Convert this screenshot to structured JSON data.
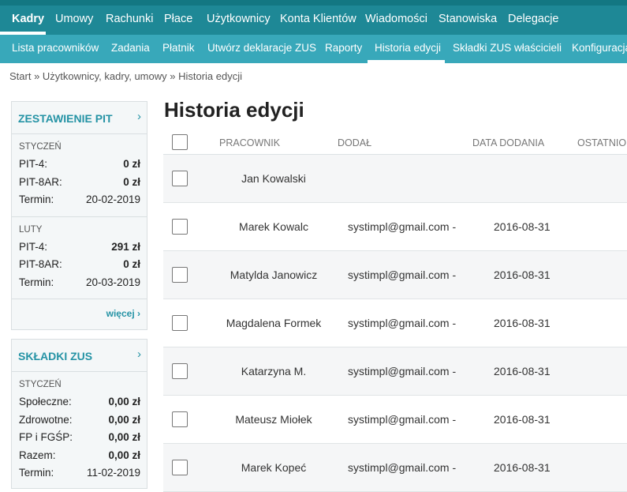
{
  "top_nav": {
    "items": [
      "Kadry",
      "Umowy",
      "Rachunki",
      "Płace",
      "Użytkownicy",
      "Konta Klientów",
      "Wiadomości",
      "Stanowiska",
      "Delegacje"
    ],
    "active": "Kadry"
  },
  "sub_nav": {
    "items": [
      "Lista pracowników",
      "Zadania",
      "Płatnik",
      "Utwórz deklaracje ZUS",
      "Raporty",
      "Historia edycji",
      "Składki ZUS właścicieli",
      "Konfiguracja"
    ],
    "active": "Historia edycji"
  },
  "breadcrumb": "Start » Użytkownicy, kadry, umowy » Historia edycji",
  "pit_panel": {
    "title": "ZESTAWIENIE PIT",
    "months": [
      {
        "month": "STYCZEŃ",
        "rows": [
          {
            "label": "PIT-4:",
            "value": "0 zł"
          },
          {
            "label": "PIT-8AR:",
            "value": "0 zł"
          },
          {
            "label": "Termin:",
            "value": "20-02-2019"
          }
        ]
      },
      {
        "month": "LUTY",
        "rows": [
          {
            "label": "PIT-4:",
            "value": "291 zł"
          },
          {
            "label": "PIT-8AR:",
            "value": "0 zł"
          },
          {
            "label": "Termin:",
            "value": "20-03-2019"
          }
        ]
      }
    ],
    "more": "więcej"
  },
  "zus_panel": {
    "title": "SKŁADKI ZUS",
    "month": "STYCZEŃ",
    "rows": [
      {
        "label": "Społeczne:",
        "value": "0,00 zł"
      },
      {
        "label": "Zdrowotne:",
        "value": "0,00 zł"
      },
      {
        "label": "FP i FGŚP:",
        "value": "0,00 zł"
      },
      {
        "label": "Razem:",
        "value": "0,00 zł"
      },
      {
        "label": "Termin:",
        "value": "11-02-2019"
      }
    ]
  },
  "page_title": "Historia edycji",
  "table": {
    "columns": [
      "PRACOWNIK",
      "DODAŁ",
      "DATA DODANIA",
      "OSTATNIO"
    ],
    "rows": [
      {
        "employee": "Jan Kowalski",
        "added_by": "",
        "date": ""
      },
      {
        "employee": "Marek Kowalc",
        "added_by": "systimpl@gmail.com -",
        "date": "2016-08-31"
      },
      {
        "employee": "Matylda Janowicz",
        "added_by": "systimpl@gmail.com -",
        "date": "2016-08-31"
      },
      {
        "employee": "Magdalena Formek",
        "added_by": "systimpl@gmail.com -",
        "date": "2016-08-31"
      },
      {
        "employee": "Katarzyna M.",
        "added_by": "systimpl@gmail.com -",
        "date": "2016-08-31"
      },
      {
        "employee": "Mateusz Miołek",
        "added_by": "systimpl@gmail.com -",
        "date": "2016-08-31"
      },
      {
        "employee": "Marek Kopeć",
        "added_by": "systimpl@gmail.com -",
        "date": "2016-08-31"
      }
    ]
  },
  "colors": {
    "topnav_bg": "#1e8896",
    "subnav_bg": "#38a8ba",
    "accent": "#2593a5"
  }
}
